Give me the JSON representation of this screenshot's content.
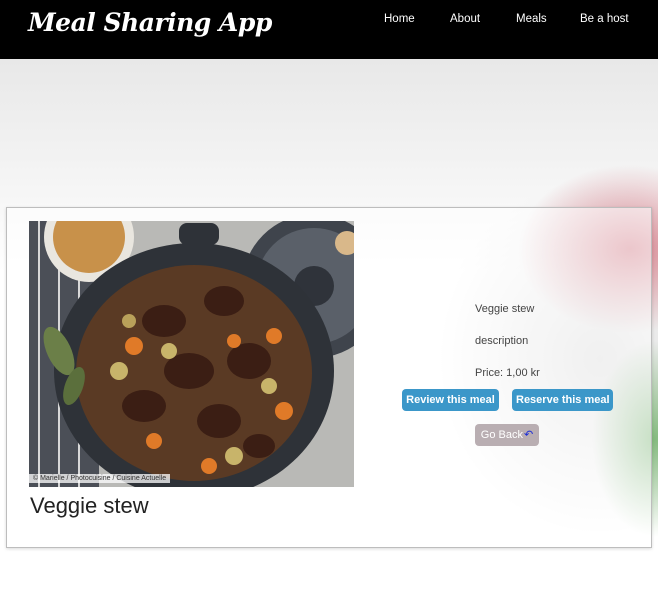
{
  "header": {
    "app_title": "Meal Sharing App",
    "nav": [
      {
        "label": "Home"
      },
      {
        "label": "About"
      },
      {
        "label": "Meals"
      },
      {
        "label": "Be a host"
      }
    ]
  },
  "meal": {
    "title": "Veggie stew",
    "name": "Veggie stew",
    "description": "description",
    "price": "Price: 1,00 kr",
    "photo_credit": "© Marielle / Photocuisine / Cuisine Actuelle",
    "photo_icon": "stew-pot-image"
  },
  "actions": {
    "review_label": "Review this meal",
    "reserve_label": "Reserve this meal",
    "back_label": "Go Back",
    "back_icon": "undo-arrow-icon"
  },
  "colors": {
    "header_bg": "#000000",
    "button_blue": "#3b97c9",
    "button_grey": "#b9aeb2"
  }
}
